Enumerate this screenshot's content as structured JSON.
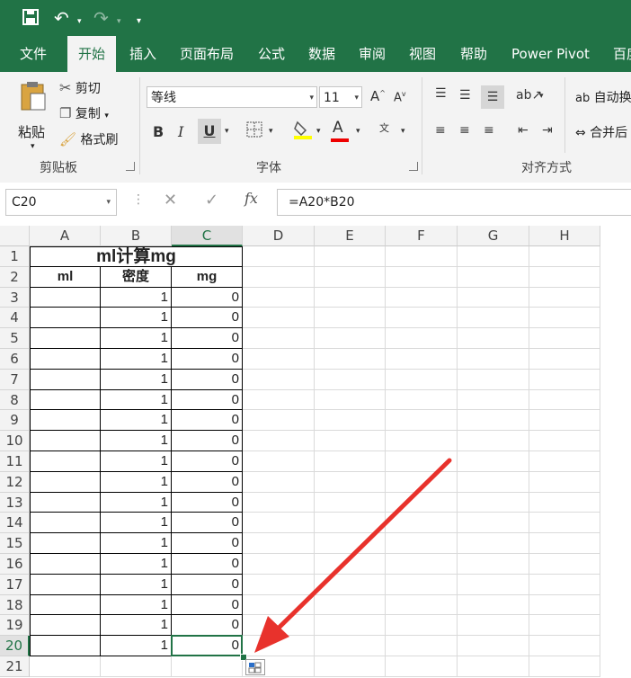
{
  "tabs": [
    "文件",
    "开始",
    "插入",
    "页面布局",
    "公式",
    "数据",
    "审阅",
    "视图",
    "帮助",
    "Power Pivot",
    "百度"
  ],
  "active_tab": "开始",
  "clipboard": {
    "paste": "粘贴",
    "cut": "剪切",
    "copy": "复制",
    "format_painter": "格式刷",
    "group": "剪贴板"
  },
  "font": {
    "name": "等线",
    "size": "11",
    "group": "字体"
  },
  "alignment": {
    "wrap": "自动换",
    "merge": "合并后",
    "group": "对齐方式"
  },
  "formula_bar": {
    "name_box": "C20",
    "formula": "=A20*B20",
    "fx": "fx"
  },
  "columns": [
    "A",
    "B",
    "C",
    "D",
    "E",
    "F",
    "G",
    "H"
  ],
  "selected_column": "C",
  "selected_row": 20,
  "sheet": {
    "title": "ml计算mg",
    "headers": [
      "ml",
      "密度",
      "mg"
    ],
    "rows": [
      [
        "",
        "1",
        "0"
      ],
      [
        "",
        "1",
        "0"
      ],
      [
        "",
        "1",
        "0"
      ],
      [
        "",
        "1",
        "0"
      ],
      [
        "",
        "1",
        "0"
      ],
      [
        "",
        "1",
        "0"
      ],
      [
        "",
        "1",
        "0"
      ],
      [
        "",
        "1",
        "0"
      ],
      [
        "",
        "1",
        "0"
      ],
      [
        "",
        "1",
        "0"
      ],
      [
        "",
        "1",
        "0"
      ],
      [
        "",
        "1",
        "0"
      ],
      [
        "",
        "1",
        "0"
      ],
      [
        "",
        "1",
        "0"
      ],
      [
        "",
        "1",
        "0"
      ],
      [
        "",
        "1",
        "0"
      ],
      [
        "",
        "1",
        "0"
      ],
      [
        "",
        "1",
        "0"
      ]
    ]
  },
  "row_numbers": [
    "1",
    "2",
    "3",
    "4",
    "5",
    "6",
    "7",
    "8",
    "9",
    "10",
    "11",
    "12",
    "13",
    "14",
    "15",
    "16",
    "17",
    "18",
    "19",
    "20",
    "21"
  ],
  "colors": {
    "accent": "#217346",
    "arrow": "#e8322c"
  }
}
